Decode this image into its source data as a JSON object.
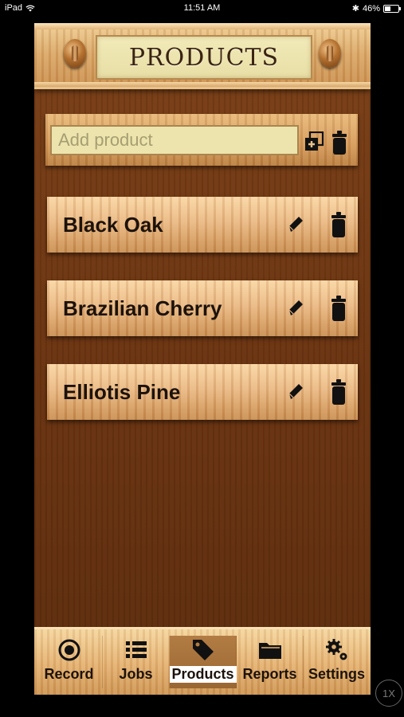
{
  "status_bar": {
    "device": "iPad",
    "time": "11:51 AM",
    "battery": "46%",
    "battery_level": 0.46
  },
  "header": {
    "title": "PRODUCTS"
  },
  "add_product": {
    "placeholder": "Add product",
    "value": ""
  },
  "products": [
    {
      "name": "Black Oak"
    },
    {
      "name": "Brazilian Cherry"
    },
    {
      "name": "Elliotis Pine"
    }
  ],
  "tabs": [
    {
      "label": "Record",
      "icon": "record-icon",
      "active": false
    },
    {
      "label": "Jobs",
      "icon": "list-icon",
      "active": false
    },
    {
      "label": "Products",
      "icon": "tags-icon",
      "active": true
    },
    {
      "label": "Reports",
      "icon": "folder-icon",
      "active": false
    },
    {
      "label": "Settings",
      "icon": "gears-icon",
      "active": false
    }
  ],
  "zoom": "1X",
  "colors": {
    "background_wood": "#6a3310",
    "plate": "#ece4ac",
    "text_dark": "#1c120a"
  }
}
